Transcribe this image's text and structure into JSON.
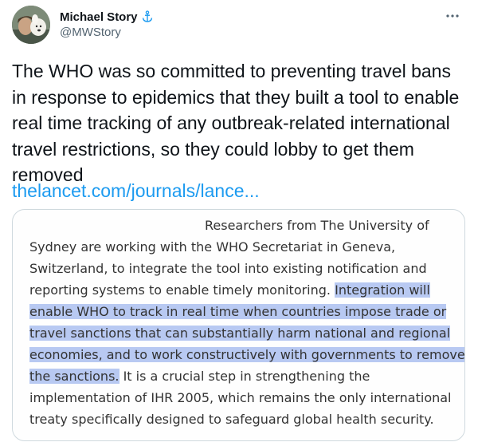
{
  "author": {
    "display_name": "Michael Story",
    "handle": "@MWStory",
    "badge_icon": "anchor-icon",
    "avatar_icon": "avatar-photo"
  },
  "more_icon": "more-icon",
  "tweet": {
    "text": "The WHO was so committed to preventing travel bans in response to epidemics that they built a tool to enable real time tracking of any outbreak-related international travel restrictions, so they could lobby to get them removed",
    "link_text": "thelancet.com/journals/lance..."
  },
  "excerpt": {
    "lines": [
      [
        {
          "t": "Researchers from The University of",
          "h": false
        }
      ],
      [
        {
          "t": "Sydney are working with the WHO Secretariat in Geneva,",
          "h": false
        }
      ],
      [
        {
          "t": "Switzerland, to integrate the tool into existing notification and",
          "h": false
        }
      ],
      [
        {
          "t": "reporting systems to enable timely monitoring. ",
          "h": false
        },
        {
          "t": "Integration will",
          "h": true
        }
      ],
      [
        {
          "t": "enable WHO to track in real time when countries impose trade or",
          "h": true
        }
      ],
      [
        {
          "t": "travel sanctions that can substantially harm national and regional",
          "h": true
        }
      ],
      [
        {
          "t": "economies, and to work constructively with governments to remove",
          "h": true
        }
      ],
      [
        {
          "t": "the sanctions.",
          "h": true
        },
        {
          "t": " It is a crucial step in strengthening the",
          "h": false
        }
      ],
      [
        {
          "t": "implementation of IHR 2005, which remains the only international",
          "h": false
        }
      ],
      [
        {
          "t": "treaty specifically designed to safeguard global health security.",
          "h": false
        }
      ]
    ]
  },
  "colors": {
    "link": "#1d9bf0",
    "highlight": "#b8c9f2",
    "secondary_text": "#536471",
    "border": "#cfd9de"
  }
}
